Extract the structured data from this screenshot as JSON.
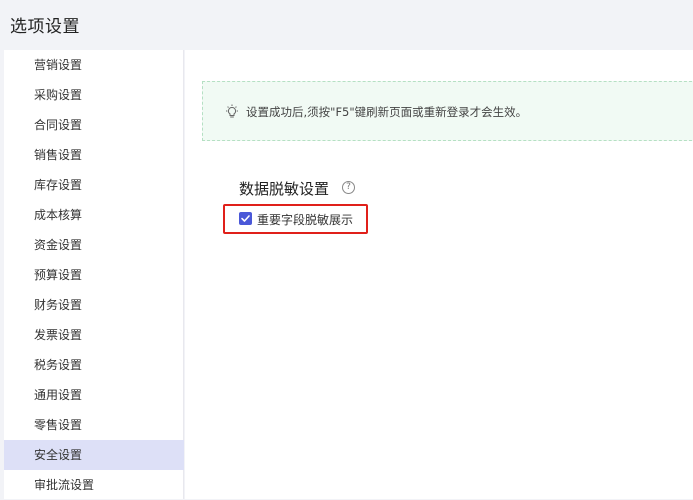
{
  "header": {
    "title": "选项设置"
  },
  "sidebar": {
    "items": [
      {
        "label": "营销设置"
      },
      {
        "label": "采购设置"
      },
      {
        "label": "合同设置"
      },
      {
        "label": "销售设置"
      },
      {
        "label": "库存设置"
      },
      {
        "label": "成本核算"
      },
      {
        "label": "资金设置"
      },
      {
        "label": "预算设置"
      },
      {
        "label": "财务设置"
      },
      {
        "label": "发票设置"
      },
      {
        "label": "税务设置"
      },
      {
        "label": "通用设置"
      },
      {
        "label": "零售设置"
      },
      {
        "label": "安全设置"
      },
      {
        "label": "审批流设置"
      }
    ],
    "active_index": 13
  },
  "notice": {
    "icon": "lightbulb-icon",
    "text": "设置成功后,须按\"F5\"键刷新页面或重新登录才会生效。"
  },
  "section": {
    "title": "数据脱敏设置",
    "help_icon": "question-circle-icon",
    "help_glyph": "?"
  },
  "option": {
    "label": "重要字段脱敏展示",
    "checked": true
  },
  "colors": {
    "accent": "#4a58d8",
    "active_bg": "#dde0f7",
    "highlight": "#e0201a",
    "notice_bg": "#f1faf4"
  }
}
